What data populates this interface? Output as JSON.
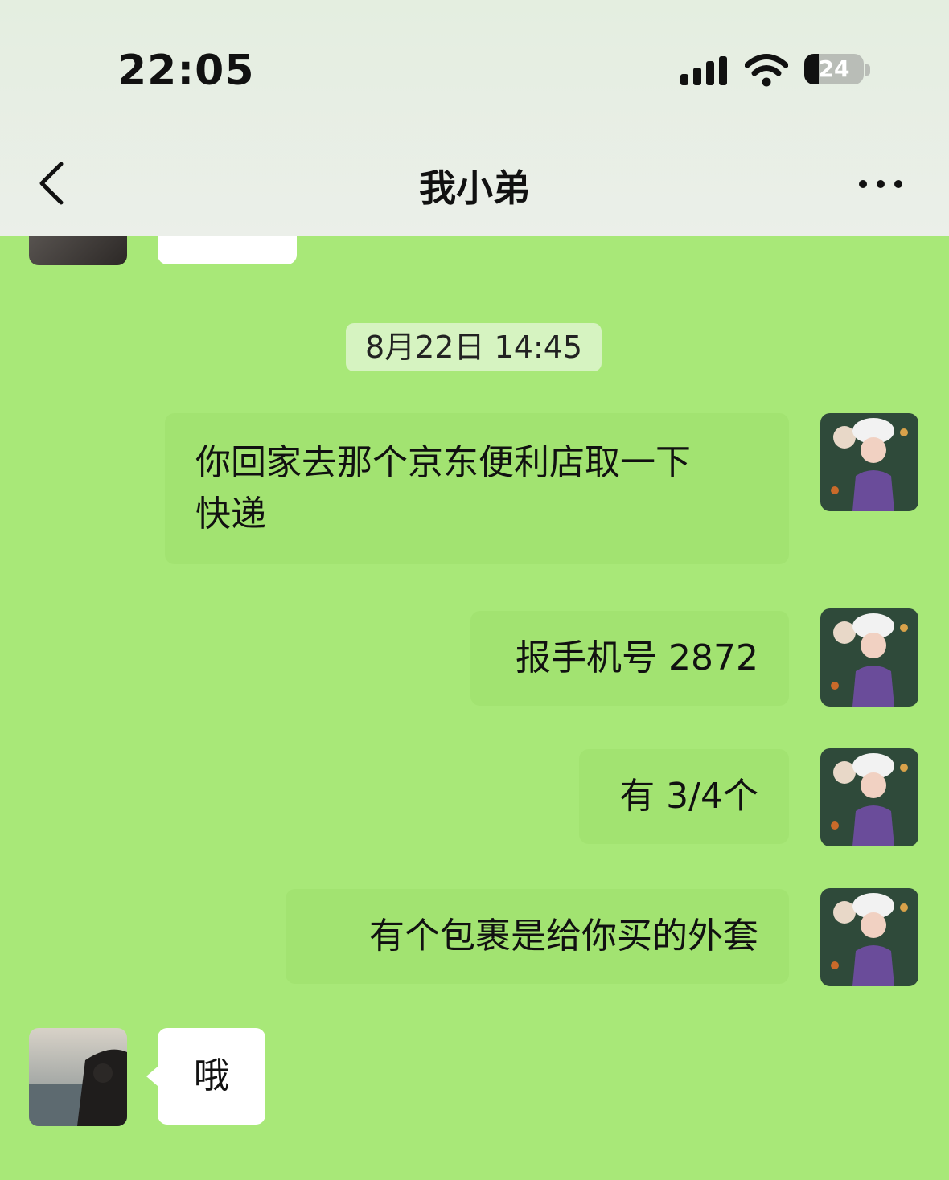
{
  "status_bar": {
    "time": "22:05",
    "battery_level": "24",
    "battery_fraction": 0.24
  },
  "header": {
    "title": "我小弟",
    "back_icon": "chevron-left-icon",
    "more_icon": "more-dots-icon"
  },
  "chat": {
    "timestamp": "8月22日 14:45",
    "messages": [
      {
        "side": "right",
        "lines": [
          "你回家去那个京东便利店取一下",
          "快递"
        ]
      },
      {
        "side": "right",
        "lines": [
          "报手机号 2872"
        ]
      },
      {
        "side": "right",
        "lines": [
          "有 3/4个"
        ]
      },
      {
        "side": "right",
        "lines": [
          "有个包裹是给你买的外套"
        ]
      },
      {
        "side": "left",
        "lines": [
          "哦"
        ]
      }
    ]
  },
  "colors": {
    "background": "#a8e878",
    "sent_bubble": "#a2e371",
    "received_bubble": "#ffffff",
    "header_bg": "#e8eee4"
  }
}
